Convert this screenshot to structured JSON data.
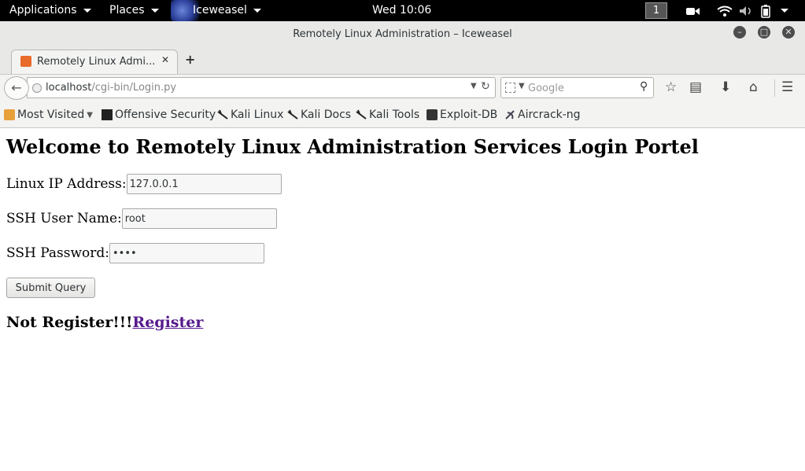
{
  "topbar": {
    "applications": "Applications",
    "places": "Places",
    "app_name": "Iceweasel",
    "clock": "Wed 10:06",
    "workspace": "1"
  },
  "window": {
    "title": "Remotely Linux Administration – Iceweasel"
  },
  "tab": {
    "title": "Remotely Linux Admi..."
  },
  "navbar": {
    "url_host": "localhost",
    "url_path": "/cgi-bin/Login.py",
    "search_placeholder": "Google"
  },
  "bookmarks": [
    {
      "label": "Most Visited",
      "icon": "folder-icon"
    },
    {
      "label": "Offensive Security",
      "icon": "offsec-icon"
    },
    {
      "label": "Kali Linux",
      "icon": "kali-dragon-icon"
    },
    {
      "label": "Kali Docs",
      "icon": "kali-dragon-icon"
    },
    {
      "label": "Kali Tools",
      "icon": "kali-dragon-icon"
    },
    {
      "label": "Exploit-DB",
      "icon": "exploitdb-icon"
    },
    {
      "label": "Aircrack-ng",
      "icon": "aircrack-icon"
    }
  ],
  "page": {
    "heading": "Welcome to Remotely Linux Administration Services Login Portel",
    "ip_label": "Linux IP Address:",
    "ip_value": "127.0.0.1",
    "user_label": "SSH User Name:",
    "user_value": "root",
    "password_label": "SSH Password:",
    "password_value": "root",
    "submit_label": "Submit Query",
    "not_registered": "Not Register!!!",
    "register_link": "Register"
  }
}
